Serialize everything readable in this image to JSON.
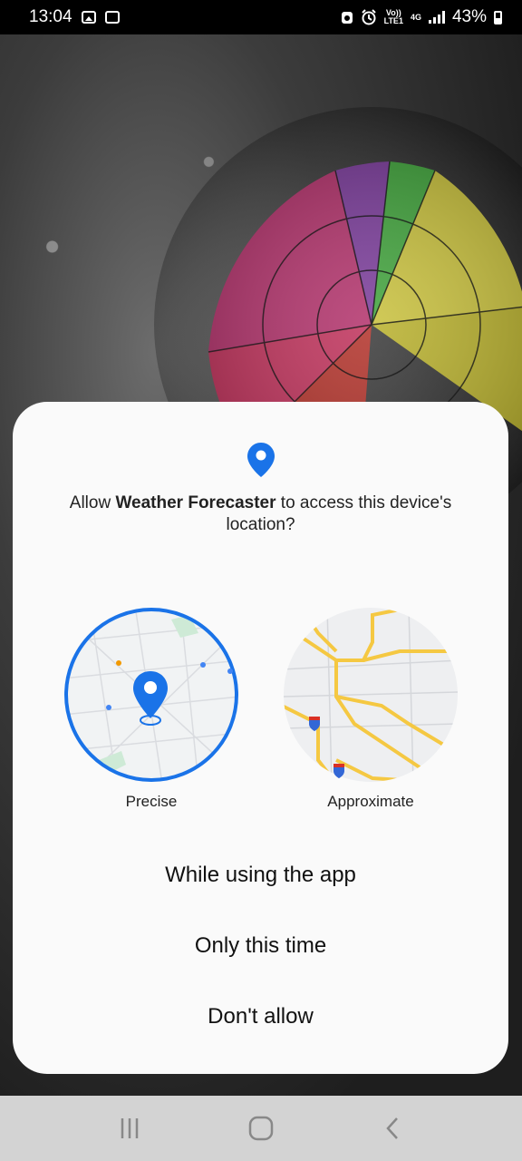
{
  "status_bar": {
    "time": "13:04",
    "volte_top": "Vo))",
    "volte_bottom": "LTE1",
    "network": "4G",
    "battery": "43%",
    "icons": [
      "gallery-icon",
      "clipboard-icon",
      "recycle-icon",
      "alarm-icon",
      "signal-icon",
      "battery-icon"
    ]
  },
  "dialog": {
    "message_prefix": "Allow ",
    "app_name": "Weather Forecaster",
    "message_suffix": " to access this device's location?",
    "precise_label": "Precise",
    "approximate_label": "Approximate",
    "selected_option": "Precise",
    "buttons": {
      "while_using": "While using the app",
      "only_this_time": "Only this time",
      "dont_allow": "Don't allow"
    }
  },
  "colors": {
    "accent": "#1a73e8",
    "road_yellow": "#f5c842",
    "dialog_bg": "#fafafa",
    "nav_bg": "#d3d3d3"
  },
  "nav_bar": {
    "icons": [
      "recents-icon",
      "home-icon",
      "back-icon"
    ]
  }
}
